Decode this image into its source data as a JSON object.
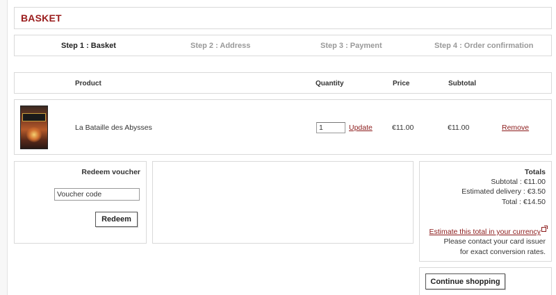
{
  "page": {
    "title": "BASKET"
  },
  "steps": [
    {
      "label": "Step 1 : Basket",
      "active": true
    },
    {
      "label": "Step 2 : Address",
      "active": false
    },
    {
      "label": "Step 3 : Payment",
      "active": false
    },
    {
      "label": "Step 4 : Order confirmation",
      "active": false
    }
  ],
  "table": {
    "headers": {
      "product": "Product",
      "quantity": "Quantity",
      "price": "Price",
      "subtotal": "Subtotal"
    },
    "rows": [
      {
        "image_icon": "book-cover-image",
        "product": "La Bataille des Abysses",
        "quantity": "1",
        "update_label": "Update",
        "price": "€11.00",
        "subtotal": "€11.00",
        "remove_label": "Remove"
      }
    ]
  },
  "voucher": {
    "title": "Redeem voucher",
    "input_value": "Voucher code",
    "button_label": "Redeem"
  },
  "totals": {
    "title": "Totals",
    "subtotal": "Subtotal : €11.00",
    "delivery": "Estimated delivery : €3.50",
    "total": "Total : €14.50",
    "estimate_link": "Estimate this total in your currency",
    "note_line1": "Please contact your card issuer",
    "note_line2": "for exact conversion rates."
  },
  "actions": {
    "continue_label": "Continue shopping"
  },
  "colors": {
    "accent": "#9a1b1b",
    "link": "#8b1a1a",
    "border": "#d9d9d9"
  }
}
